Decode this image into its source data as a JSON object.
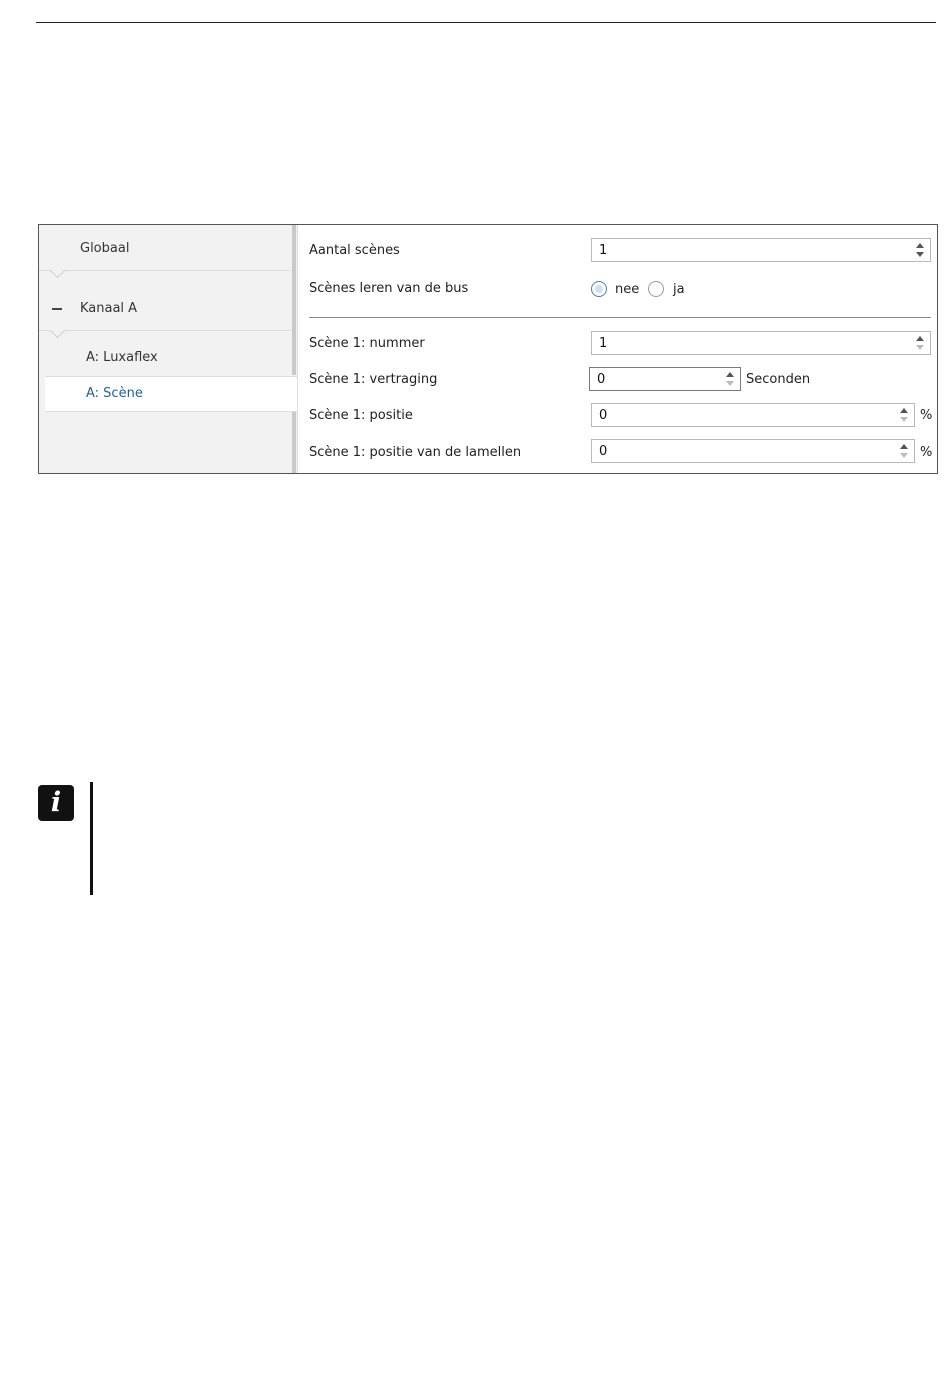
{
  "sidebar": {
    "items": [
      {
        "label": "Globaal"
      },
      {
        "label": "Kanaal A"
      },
      {
        "label": "A: Luxaflex"
      },
      {
        "label": "A: Scène"
      }
    ]
  },
  "params": {
    "aantal_scenes": {
      "label": "Aantal scènes",
      "value": "1"
    },
    "leren": {
      "label": "Scènes leren van de bus",
      "options": [
        "nee",
        "ja"
      ],
      "selected": "nee"
    },
    "nummer": {
      "label": "Scène 1: nummer",
      "value": "1"
    },
    "vertraging": {
      "label": "Scène 1: vertraging",
      "value": "0",
      "unit": "Seconden"
    },
    "positie": {
      "label": "Scène 1: positie",
      "value": "0",
      "unit": "%"
    },
    "lamellen": {
      "label": "Scène 1: positie van de lamellen",
      "value": "0",
      "unit": "%"
    }
  },
  "icons": {
    "info": "info-icon",
    "info_glyph": "i",
    "collapse": "minus-icon"
  },
  "colors": {
    "active_nav": "#1f5fa6",
    "radio_selected": "#4a7fb5"
  }
}
